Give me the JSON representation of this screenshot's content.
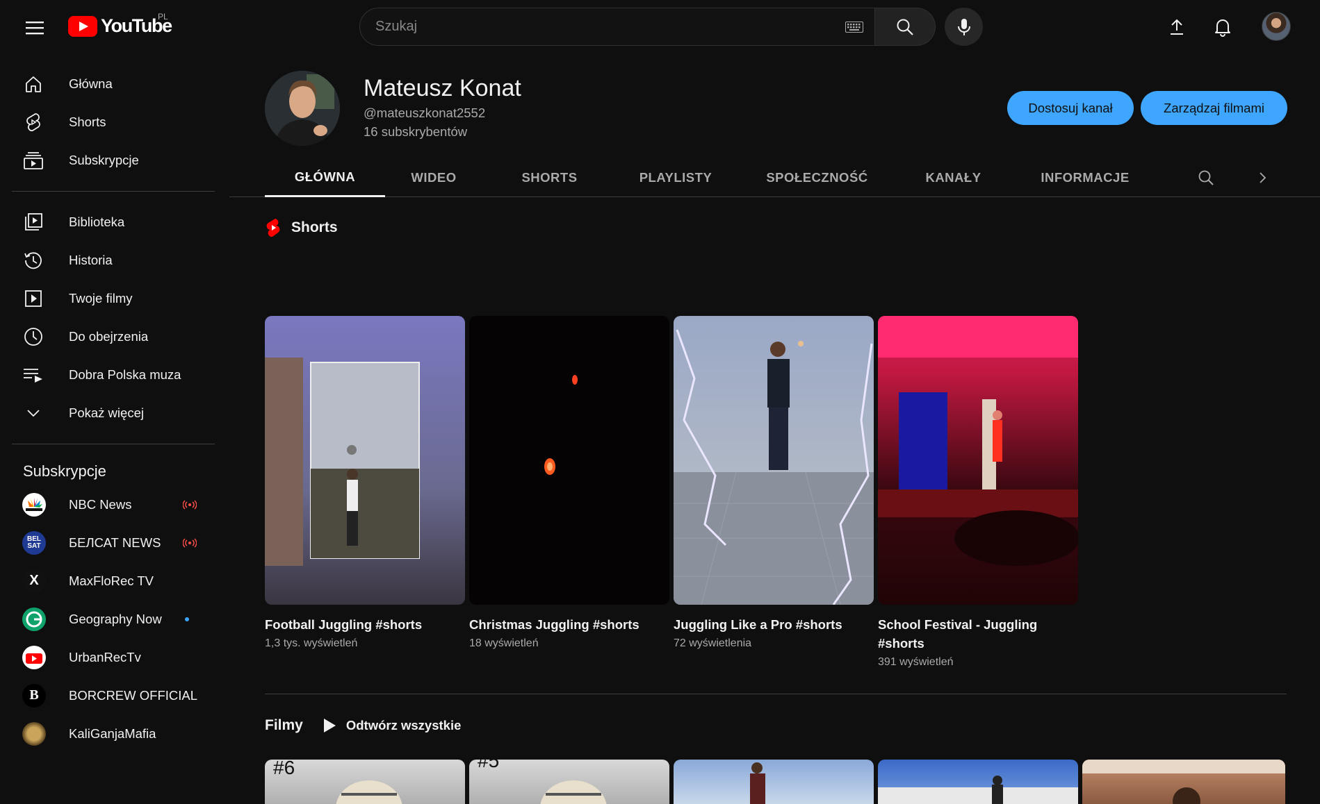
{
  "topbar": {
    "logo_text": "YouTube",
    "country": "PL",
    "search_placeholder": "Szukaj"
  },
  "sidebar": {
    "main_items": [
      {
        "label": "Główna",
        "icon": "home-icon"
      },
      {
        "label": "Shorts",
        "icon": "shorts-icon"
      },
      {
        "label": "Subskrypcje",
        "icon": "subscriptions-icon"
      }
    ],
    "library_items": [
      {
        "label": "Biblioteka",
        "icon": "library-icon"
      },
      {
        "label": "Historia",
        "icon": "history-icon"
      },
      {
        "label": "Twoje filmy",
        "icon": "your-videos-icon"
      },
      {
        "label": "Do obejrzenia",
        "icon": "watch-later-icon"
      },
      {
        "label": "Dobra Polska muza",
        "icon": "playlist-icon"
      },
      {
        "label": "Pokaż więcej",
        "icon": "chevron-down-icon"
      }
    ],
    "subscriptions_heading": "Subskrypcje",
    "subscriptions": [
      {
        "label": "NBC News",
        "status": "live"
      },
      {
        "label": "БЕЛСАТ NEWS",
        "status": "live"
      },
      {
        "label": "MaxFloRec TV",
        "status": ""
      },
      {
        "label": "Geography Now",
        "status": "new"
      },
      {
        "label": "UrbanRecTv",
        "status": ""
      },
      {
        "label": "BORCREW OFFICIAL",
        "status": ""
      },
      {
        "label": "KaliGanjaMafia",
        "status": ""
      }
    ],
    "avatar_text": {
      "belsat": "BEL SAT",
      "maxflo": "X",
      "borcrew": "B"
    }
  },
  "channel": {
    "name": "Mateusz Konat",
    "handle": "@mateuszkonat2552",
    "subscribers": "16 subskrybentów",
    "customize_button": "Dostosuj kanał",
    "manage_button": "Zarządzaj filmami"
  },
  "tabs": [
    "GŁÓWNA",
    "WIDEO",
    "SHORTS",
    "PLAYLISTY",
    "SPOŁECZNOŚĆ",
    "KANAŁY",
    "INFORMACJE"
  ],
  "shorts_section": {
    "title": "Shorts",
    "items": [
      {
        "title": "Football Juggling #shorts",
        "views": "1,3 tys. wyświetleń"
      },
      {
        "title": "Christmas Juggling #shorts",
        "views": "18 wyświetleń"
      },
      {
        "title": "Juggling Like a Pro #shorts",
        "views": "72 wyświetlenia"
      },
      {
        "title": "School Festival - Juggling #shorts",
        "views": "391 wyświetleń"
      }
    ]
  },
  "films_section": {
    "title": "Filmy",
    "play_all": "Odtwórz wszystkie",
    "thumb_labels": [
      "#6",
      "#5"
    ]
  },
  "colors": {
    "background": "#0f0f0f",
    "accent_blue": "#3ea6ff",
    "youtube_red": "#ff0000",
    "text_secondary": "#aaaaaa"
  }
}
